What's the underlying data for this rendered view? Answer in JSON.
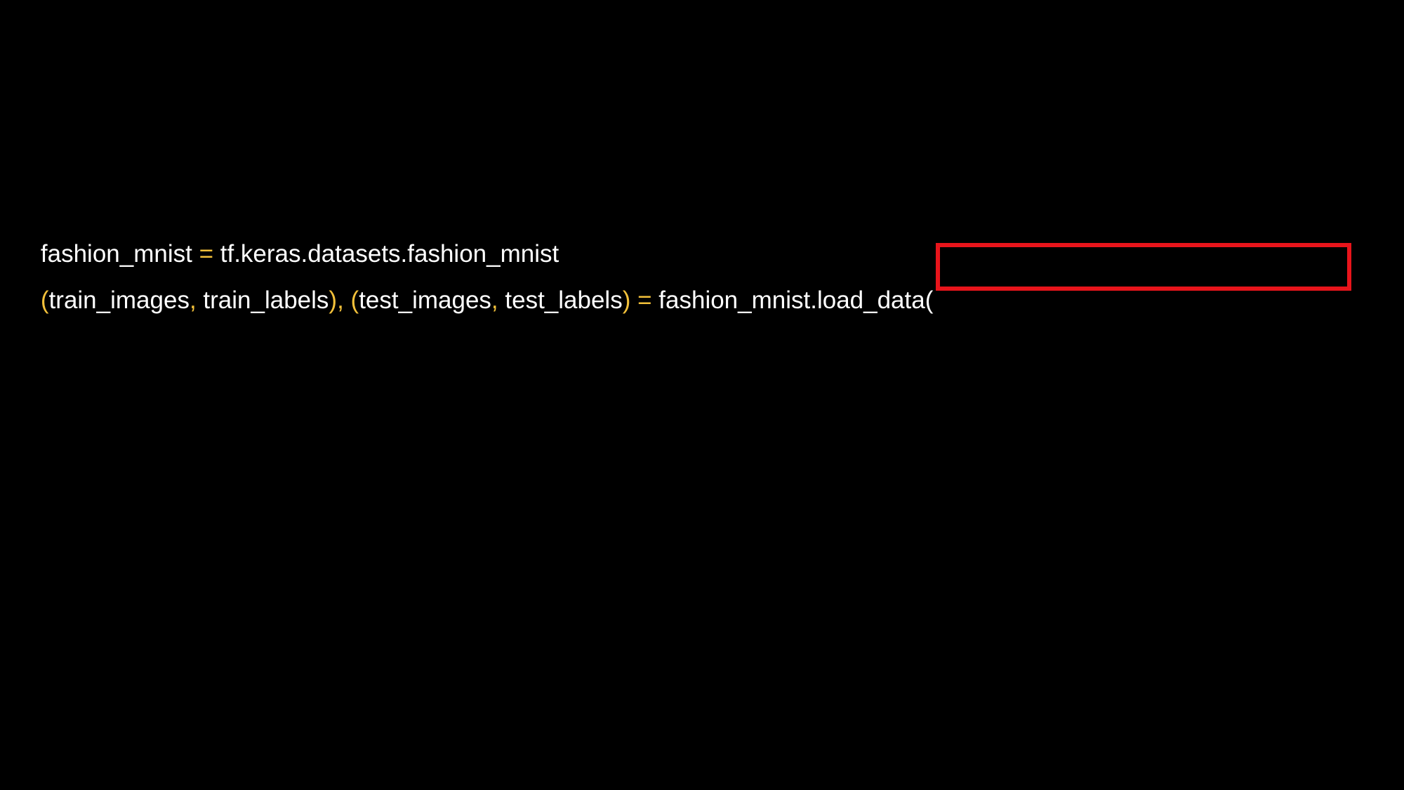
{
  "colors": {
    "background": "#000000",
    "text": "#ffffff",
    "operator": "#f3c13a",
    "highlight_border": "#e8141b"
  },
  "code": {
    "line1": [
      {
        "text": "fashion_mnist ",
        "kind": "id"
      },
      {
        "text": "=",
        "kind": "op"
      },
      {
        "text": " tf.keras.datasets.fashion_mnist",
        "kind": "id"
      }
    ],
    "line2": [
      {
        "text": "(",
        "kind": "op"
      },
      {
        "text": "train_images",
        "kind": "id"
      },
      {
        "text": ",",
        "kind": "op"
      },
      {
        "text": " train_labels",
        "kind": "id"
      },
      {
        "text": ")",
        "kind": "op"
      },
      {
        "text": ",",
        "kind": "op"
      },
      {
        "text": " ",
        "kind": "id"
      },
      {
        "text": "(",
        "kind": "op"
      },
      {
        "text": "test_images",
        "kind": "id"
      },
      {
        "text": ",",
        "kind": "op"
      },
      {
        "text": " test_labels",
        "kind": "id"
      },
      {
        "text": ")",
        "kind": "op"
      },
      {
        "text": " ",
        "kind": "id"
      },
      {
        "text": "=",
        "kind": "op"
      },
      {
        "text": " fashion_mnist.load_data(",
        "kind": "id"
      }
    ]
  }
}
